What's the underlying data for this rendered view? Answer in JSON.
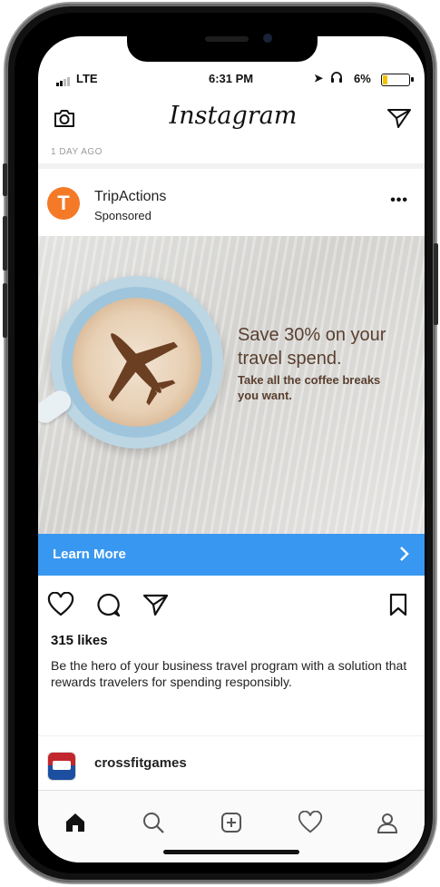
{
  "status": {
    "signal": "signal-bars-icon",
    "network": "LTE",
    "time": "6:31 PM",
    "location": "location-arrow-icon",
    "headphones": "headphones-icon",
    "battery_percent": "6%",
    "battery_level": 0.06,
    "battery_color": "#f2c200"
  },
  "header": {
    "logo_text": "Instagram",
    "camera_icon": "camera-icon",
    "dm_icon": "paper-plane-icon"
  },
  "feed": {
    "prev_post_age": "1 DAY AGO"
  },
  "post": {
    "account": "TripActions",
    "sponsored": "Sponsored",
    "avatar_letter": "T",
    "avatar_color": "#f47a28",
    "more_label": "•••",
    "ad": {
      "headline": "Save 30% on your travel spend.",
      "subline": "Take all the coffee breaks you want."
    },
    "cta": {
      "label": "Learn More",
      "color": "#3897f0"
    },
    "likes": "315 likes",
    "caption": "Be the hero of your business travel program with a solution that rewards travelers for spending responsibly."
  },
  "next_post": {
    "account": "crossfitgames"
  },
  "tabbar": {
    "items": [
      "home-icon",
      "search-icon",
      "new-post-icon",
      "activity-heart-icon",
      "profile-icon"
    ]
  }
}
